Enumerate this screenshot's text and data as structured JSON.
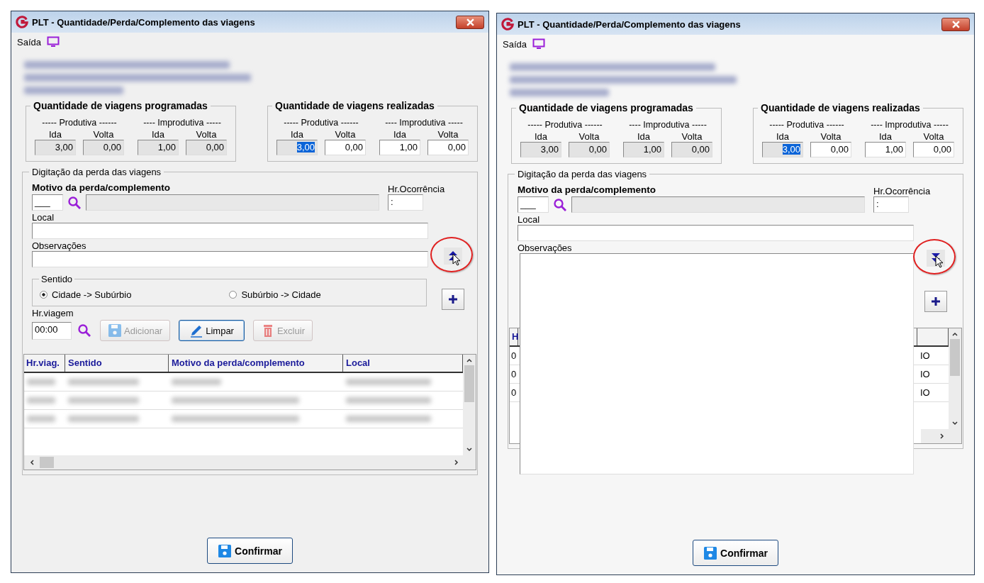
{
  "windows": [
    {
      "title": "PLT - Quantidade/Perda/Complemento das viagens",
      "menu": [
        {
          "label": "Saída"
        }
      ],
      "info": {
        "redacted": true
      },
      "groups": [
        {
          "title": "Quantidade de viagens programadas",
          "sections": [
            {
              "label": "----- Produtiva ------",
              "fields": [
                {
                  "label": "Ida",
                  "value": "3,00",
                  "disabled": true,
                  "selected": false
                },
                {
                  "label": "Volta",
                  "value": "0,00",
                  "disabled": true,
                  "selected": false
                }
              ]
            },
            {
              "label": "---- Improdutiva -----",
              "fields": [
                {
                  "label": "Ida",
                  "value": "1,00",
                  "disabled": true,
                  "selected": false
                },
                {
                  "label": "Volta",
                  "value": "0,00",
                  "disabled": true,
                  "selected": false
                }
              ]
            }
          ]
        },
        {
          "title": "Quantidade de viagens realizadas",
          "sections": [
            {
              "label": "----- Produtiva ------",
              "fields": [
                {
                  "label": "Ida",
                  "value": "3,00",
                  "disabled": true,
                  "selected": true
                },
                {
                  "label": "Volta",
                  "value": "0,00",
                  "disabled": false,
                  "selected": false
                }
              ]
            },
            {
              "label": "---- Improdutiva -----",
              "fields": [
                {
                  "label": "Ida",
                  "value": "1,00",
                  "disabled": false,
                  "selected": false
                },
                {
                  "label": "Volta",
                  "value": "0,00",
                  "disabled": false,
                  "selected": false
                }
              ]
            }
          ]
        }
      ],
      "entry": {
        "legend": "Digitação da perda das viagens",
        "reason_label": "Motivo da perda/complemento",
        "reason_code": "___",
        "time_label": "Hr.Ocorrência",
        "time_value": ":",
        "place_label": "Local",
        "notes_label": "Observações",
        "notes_expanded": false,
        "highlighted": true,
        "direction": {
          "legend": "Sentido",
          "options": [
            {
              "label": "Cidade -> Subúrbio",
              "selected": true
            },
            {
              "label": "Subúrbio -> Cidade",
              "selected": false
            }
          ]
        },
        "trip_time": {
          "label": "Hr.viagem",
          "value": "00:00"
        },
        "actions": [
          {
            "label": "Adicionar",
            "kind": "save",
            "disabled": true,
            "focused": false
          },
          {
            "label": "Limpar",
            "kind": "edit",
            "disabled": false,
            "focused": true
          },
          {
            "label": "Excluir",
            "kind": "delete",
            "disabled": true,
            "focused": false
          }
        ]
      },
      "table": {
        "kind": "full",
        "columns": [
          "Hr.viag.",
          "Sentido",
          "Motivo da perda/complemento",
          "Local"
        ],
        "rows": [
          {
            "redacted": true
          },
          {
            "redacted": true
          },
          {
            "redacted": true
          }
        ]
      },
      "confirm": {
        "label": "Confirmar"
      }
    },
    {
      "title": "PLT - Quantidade/Perda/Complemento das viagens",
      "menu": [
        {
          "label": "Saída"
        }
      ],
      "info": {
        "redacted": true
      },
      "groups": [
        {
          "title": "Quantidade de viagens programadas",
          "sections": [
            {
              "label": "----- Produtiva ------",
              "fields": [
                {
                  "label": "Ida",
                  "value": "3,00",
                  "disabled": true,
                  "selected": false
                },
                {
                  "label": "Volta",
                  "value": "0,00",
                  "disabled": true,
                  "selected": false
                }
              ]
            },
            {
              "label": "---- Improdutiva -----",
              "fields": [
                {
                  "label": "Ida",
                  "value": "1,00",
                  "disabled": true,
                  "selected": false
                },
                {
                  "label": "Volta",
                  "value": "0,00",
                  "disabled": true,
                  "selected": false
                }
              ]
            }
          ]
        },
        {
          "title": "Quantidade de viagens realizadas",
          "sections": [
            {
              "label": "----- Produtiva ------",
              "fields": [
                {
                  "label": "Ida",
                  "value": "3,00",
                  "disabled": true,
                  "selected": true
                },
                {
                  "label": "Volta",
                  "value": "0,00",
                  "disabled": false,
                  "selected": false
                }
              ]
            },
            {
              "label": "---- Improdutiva -----",
              "fields": [
                {
                  "label": "Ida",
                  "value": "1,00",
                  "disabled": false,
                  "selected": false
                },
                {
                  "label": "Volta",
                  "value": "0,00",
                  "disabled": false,
                  "selected": false
                }
              ]
            }
          ]
        }
      ],
      "entry": {
        "legend": "Digitação da perda das viagens",
        "reason_label": "Motivo da perda/complemento",
        "reason_code": "___",
        "time_label": "Hr.Ocorrência",
        "time_value": ":",
        "place_label": "Local",
        "notes_label": "Observações",
        "notes_expanded": true,
        "highlighted": true
      },
      "table": {
        "kind": "covered",
        "columns": [
          "H"
        ],
        "rows": [
          {
            "cells": [
              "0",
              "IO"
            ]
          },
          {
            "cells": [
              "0",
              "IO"
            ]
          },
          {
            "cells": [
              "0",
              "IO"
            ]
          }
        ]
      },
      "confirm": {
        "label": "Confirmar"
      }
    }
  ]
}
